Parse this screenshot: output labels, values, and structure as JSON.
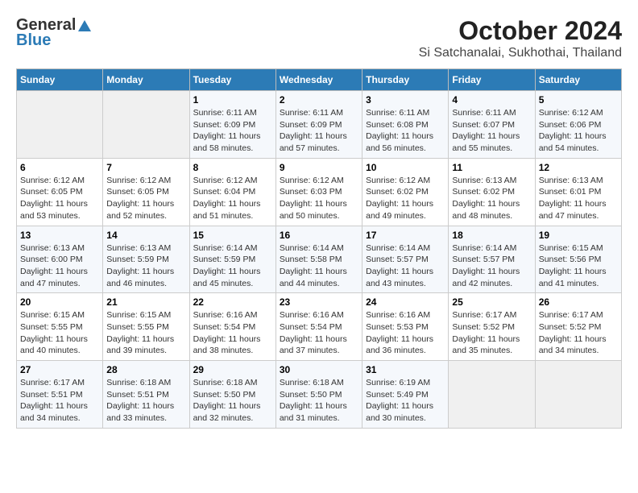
{
  "header": {
    "logo_general": "General",
    "logo_blue": "Blue",
    "month_title": "October 2024",
    "location": "Si Satchanalai, Sukhothai, Thailand"
  },
  "days_of_week": [
    "Sunday",
    "Monday",
    "Tuesday",
    "Wednesday",
    "Thursday",
    "Friday",
    "Saturday"
  ],
  "weeks": [
    [
      {
        "day": "",
        "empty": true
      },
      {
        "day": "",
        "empty": true
      },
      {
        "day": "1",
        "sunrise": "Sunrise: 6:11 AM",
        "sunset": "Sunset: 6:09 PM",
        "daylight": "Daylight: 11 hours and 58 minutes."
      },
      {
        "day": "2",
        "sunrise": "Sunrise: 6:11 AM",
        "sunset": "Sunset: 6:09 PM",
        "daylight": "Daylight: 11 hours and 57 minutes."
      },
      {
        "day": "3",
        "sunrise": "Sunrise: 6:11 AM",
        "sunset": "Sunset: 6:08 PM",
        "daylight": "Daylight: 11 hours and 56 minutes."
      },
      {
        "day": "4",
        "sunrise": "Sunrise: 6:11 AM",
        "sunset": "Sunset: 6:07 PM",
        "daylight": "Daylight: 11 hours and 55 minutes."
      },
      {
        "day": "5",
        "sunrise": "Sunrise: 6:12 AM",
        "sunset": "Sunset: 6:06 PM",
        "daylight": "Daylight: 11 hours and 54 minutes."
      }
    ],
    [
      {
        "day": "6",
        "sunrise": "Sunrise: 6:12 AM",
        "sunset": "Sunset: 6:05 PM",
        "daylight": "Daylight: 11 hours and 53 minutes."
      },
      {
        "day": "7",
        "sunrise": "Sunrise: 6:12 AM",
        "sunset": "Sunset: 6:05 PM",
        "daylight": "Daylight: 11 hours and 52 minutes."
      },
      {
        "day": "8",
        "sunrise": "Sunrise: 6:12 AM",
        "sunset": "Sunset: 6:04 PM",
        "daylight": "Daylight: 11 hours and 51 minutes."
      },
      {
        "day": "9",
        "sunrise": "Sunrise: 6:12 AM",
        "sunset": "Sunset: 6:03 PM",
        "daylight": "Daylight: 11 hours and 50 minutes."
      },
      {
        "day": "10",
        "sunrise": "Sunrise: 6:12 AM",
        "sunset": "Sunset: 6:02 PM",
        "daylight": "Daylight: 11 hours and 49 minutes."
      },
      {
        "day": "11",
        "sunrise": "Sunrise: 6:13 AM",
        "sunset": "Sunset: 6:02 PM",
        "daylight": "Daylight: 11 hours and 48 minutes."
      },
      {
        "day": "12",
        "sunrise": "Sunrise: 6:13 AM",
        "sunset": "Sunset: 6:01 PM",
        "daylight": "Daylight: 11 hours and 47 minutes."
      }
    ],
    [
      {
        "day": "13",
        "sunrise": "Sunrise: 6:13 AM",
        "sunset": "Sunset: 6:00 PM",
        "daylight": "Daylight: 11 hours and 47 minutes."
      },
      {
        "day": "14",
        "sunrise": "Sunrise: 6:13 AM",
        "sunset": "Sunset: 5:59 PM",
        "daylight": "Daylight: 11 hours and 46 minutes."
      },
      {
        "day": "15",
        "sunrise": "Sunrise: 6:14 AM",
        "sunset": "Sunset: 5:59 PM",
        "daylight": "Daylight: 11 hours and 45 minutes."
      },
      {
        "day": "16",
        "sunrise": "Sunrise: 6:14 AM",
        "sunset": "Sunset: 5:58 PM",
        "daylight": "Daylight: 11 hours and 44 minutes."
      },
      {
        "day": "17",
        "sunrise": "Sunrise: 6:14 AM",
        "sunset": "Sunset: 5:57 PM",
        "daylight": "Daylight: 11 hours and 43 minutes."
      },
      {
        "day": "18",
        "sunrise": "Sunrise: 6:14 AM",
        "sunset": "Sunset: 5:57 PM",
        "daylight": "Daylight: 11 hours and 42 minutes."
      },
      {
        "day": "19",
        "sunrise": "Sunrise: 6:15 AM",
        "sunset": "Sunset: 5:56 PM",
        "daylight": "Daylight: 11 hours and 41 minutes."
      }
    ],
    [
      {
        "day": "20",
        "sunrise": "Sunrise: 6:15 AM",
        "sunset": "Sunset: 5:55 PM",
        "daylight": "Daylight: 11 hours and 40 minutes."
      },
      {
        "day": "21",
        "sunrise": "Sunrise: 6:15 AM",
        "sunset": "Sunset: 5:55 PM",
        "daylight": "Daylight: 11 hours and 39 minutes."
      },
      {
        "day": "22",
        "sunrise": "Sunrise: 6:16 AM",
        "sunset": "Sunset: 5:54 PM",
        "daylight": "Daylight: 11 hours and 38 minutes."
      },
      {
        "day": "23",
        "sunrise": "Sunrise: 6:16 AM",
        "sunset": "Sunset: 5:54 PM",
        "daylight": "Daylight: 11 hours and 37 minutes."
      },
      {
        "day": "24",
        "sunrise": "Sunrise: 6:16 AM",
        "sunset": "Sunset: 5:53 PM",
        "daylight": "Daylight: 11 hours and 36 minutes."
      },
      {
        "day": "25",
        "sunrise": "Sunrise: 6:17 AM",
        "sunset": "Sunset: 5:52 PM",
        "daylight": "Daylight: 11 hours and 35 minutes."
      },
      {
        "day": "26",
        "sunrise": "Sunrise: 6:17 AM",
        "sunset": "Sunset: 5:52 PM",
        "daylight": "Daylight: 11 hours and 34 minutes."
      }
    ],
    [
      {
        "day": "27",
        "sunrise": "Sunrise: 6:17 AM",
        "sunset": "Sunset: 5:51 PM",
        "daylight": "Daylight: 11 hours and 34 minutes."
      },
      {
        "day": "28",
        "sunrise": "Sunrise: 6:18 AM",
        "sunset": "Sunset: 5:51 PM",
        "daylight": "Daylight: 11 hours and 33 minutes."
      },
      {
        "day": "29",
        "sunrise": "Sunrise: 6:18 AM",
        "sunset": "Sunset: 5:50 PM",
        "daylight": "Daylight: 11 hours and 32 minutes."
      },
      {
        "day": "30",
        "sunrise": "Sunrise: 6:18 AM",
        "sunset": "Sunset: 5:50 PM",
        "daylight": "Daylight: 11 hours and 31 minutes."
      },
      {
        "day": "31",
        "sunrise": "Sunrise: 6:19 AM",
        "sunset": "Sunset: 5:49 PM",
        "daylight": "Daylight: 11 hours and 30 minutes."
      },
      {
        "day": "",
        "empty": true
      },
      {
        "day": "",
        "empty": true
      }
    ]
  ]
}
